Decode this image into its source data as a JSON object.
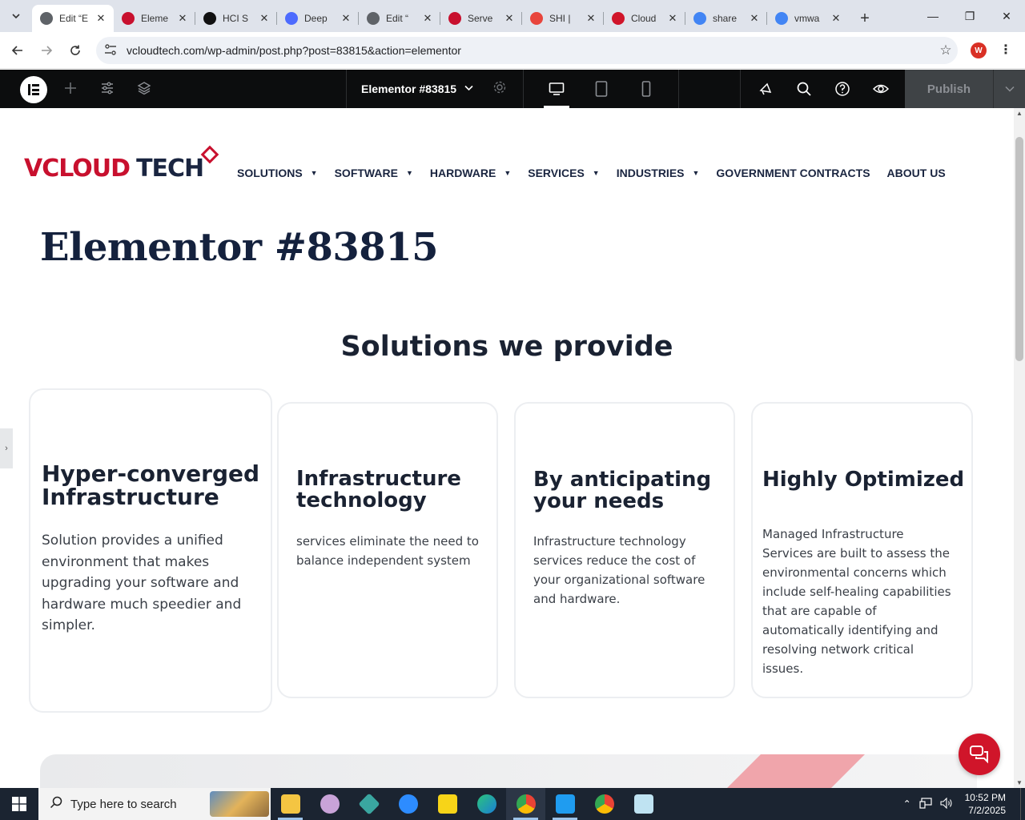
{
  "browser": {
    "tabs": [
      {
        "label": "Edit “E",
        "favicon_color": "#5f6368",
        "active": true
      },
      {
        "label": "Eleme",
        "favicon_color": "#c8102e",
        "active": false
      },
      {
        "label": "HCI S",
        "favicon_color": "#111111",
        "active": false
      },
      {
        "label": "Deep",
        "favicon_color": "#4d6bfe",
        "active": false
      },
      {
        "label": "Edit “",
        "favicon_color": "#5f6368",
        "active": false
      },
      {
        "label": "Serve",
        "favicon_color": "#c8102e",
        "active": false
      },
      {
        "label": "SHI | ",
        "favicon_color": "#e8453c",
        "active": false
      },
      {
        "label": "Cloud",
        "favicon_color": "#d0152a",
        "active": false
      },
      {
        "label": "share",
        "favicon_color": "#4285f4",
        "active": false
      },
      {
        "label": "vmwa",
        "favicon_color": "#4285f4",
        "active": false
      }
    ],
    "url": "vcloudtech.com/wp-admin/post.php?post=83815&action=elementor",
    "profile_initial": "W"
  },
  "elementor": {
    "document_title": "Elementor #83815",
    "publish_label": "Publish"
  },
  "site": {
    "logo": {
      "v": "V",
      "cloud": "CLOUD",
      "tech": "TECH"
    },
    "nav": [
      {
        "label": "SOLUTIONS",
        "dropdown": true
      },
      {
        "label": "SOFTWARE",
        "dropdown": true
      },
      {
        "label": "HARDWARE",
        "dropdown": true
      },
      {
        "label": "SERVICES",
        "dropdown": true
      },
      {
        "label": "INDUSTRIES",
        "dropdown": true
      },
      {
        "label": "GOVERNMENT CONTRACTS",
        "dropdown": false
      },
      {
        "label": "ABOUT US",
        "dropdown": false
      }
    ],
    "page_title": "Elementor #83815",
    "section_title": "Solutions we provide",
    "cards": [
      {
        "title": "Hyper-converged Infrastructure",
        "body": "Solution provides a unified environment that makes upgrading your software and hardware much speedier and simpler."
      },
      {
        "title": "Infrastructure technology",
        "body": "services eliminate the need to balance independent system"
      },
      {
        "title": "By anticipating your needs",
        "body": "Infrastructure technology services reduce the cost of your organizational software and hardware."
      },
      {
        "title": "Highly Optimized",
        "body": "Managed Infrastructure Services are built to assess the environmental concerns which include self-healing capabilities that are capable of automatically identifying and resolving network critical issues."
      }
    ],
    "accent_color": "#c8102e",
    "heading_color": "#14213d"
  },
  "taskbar": {
    "search_placeholder": "Type here to search",
    "time": "10:52 PM",
    "date": "7/2/2025"
  }
}
